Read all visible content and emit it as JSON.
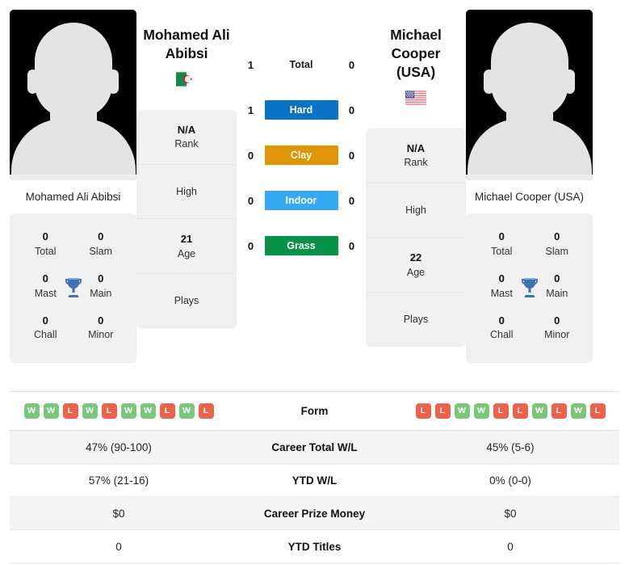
{
  "colors": {
    "win": "#79c879",
    "loss": "#f0614a",
    "hard": "#0a72c4",
    "clay": "#e09504",
    "indoor": "#36a9f5",
    "grass": "#079247",
    "trophy": "#3d74b8"
  },
  "players": {
    "left": {
      "name_line1": "Mohamed Ali",
      "name_line2": "Abibsi",
      "full_name": "Mohamed Ali Abibsi",
      "flag": "algeria-flag",
      "avatar": "player-photo-placeholder",
      "rank_value": "N/A",
      "rank_label": "Rank",
      "high_value": "",
      "high_label": "High",
      "age_value": "21",
      "age_label": "Age",
      "plays_value": "",
      "plays_label": "Plays",
      "titles": [
        {
          "num": "0",
          "label": "Total"
        },
        {
          "num": "0",
          "label": "Slam"
        },
        {
          "num": "0",
          "label": "Mast"
        },
        {
          "num": "0",
          "label": "Main"
        },
        {
          "num": "0",
          "label": "Chall"
        },
        {
          "num": "0",
          "label": "Minor"
        }
      ],
      "form": [
        "W",
        "W",
        "L",
        "W",
        "L",
        "W",
        "W",
        "L",
        "W",
        "L"
      ],
      "career_total_wl": "47% (90-100)",
      "ytd_wl": "57% (21-16)",
      "career_prize_money": "$0",
      "ytd_titles": "0"
    },
    "right": {
      "name_line1": "Michael Cooper",
      "name_line2": "(USA)",
      "full_name": "Michael Cooper (USA)",
      "flag": "usa-flag",
      "avatar": "player-photo-placeholder",
      "rank_value": "N/A",
      "rank_label": "Rank",
      "high_value": "",
      "high_label": "High",
      "age_value": "22",
      "age_label": "Age",
      "plays_value": "",
      "plays_label": "Plays",
      "titles": [
        {
          "num": "0",
          "label": "Total"
        },
        {
          "num": "0",
          "label": "Slam"
        },
        {
          "num": "0",
          "label": "Mast"
        },
        {
          "num": "0",
          "label": "Main"
        },
        {
          "num": "0",
          "label": "Chall"
        },
        {
          "num": "0",
          "label": "Minor"
        }
      ],
      "form": [
        "L",
        "L",
        "W",
        "W",
        "L",
        "L",
        "W",
        "L",
        "W",
        "L"
      ],
      "career_total_wl": "45% (5-6)",
      "ytd_wl": "0% (0-0)",
      "career_prize_money": "$0",
      "ytd_titles": "0"
    }
  },
  "h2h": [
    {
      "label": "Total",
      "left": "1",
      "right": "0",
      "style": "plain"
    },
    {
      "label": "Hard",
      "left": "1",
      "right": "0",
      "style": "hard"
    },
    {
      "label": "Clay",
      "left": "0",
      "right": "0",
      "style": "clay"
    },
    {
      "label": "Indoor",
      "left": "0",
      "right": "0",
      "style": "indoor"
    },
    {
      "label": "Grass",
      "left": "0",
      "right": "0",
      "style": "grass"
    }
  ],
  "table": {
    "rows": [
      {
        "label": "Form",
        "type": "form"
      },
      {
        "label": "Career Total W/L",
        "type": "text",
        "key": "career_total_wl"
      },
      {
        "label": "YTD W/L",
        "type": "text",
        "key": "ytd_wl"
      },
      {
        "label": "Career Prize Money",
        "type": "text",
        "key": "career_prize_money"
      },
      {
        "label": "YTD Titles",
        "type": "text",
        "key": "ytd_titles"
      }
    ]
  }
}
